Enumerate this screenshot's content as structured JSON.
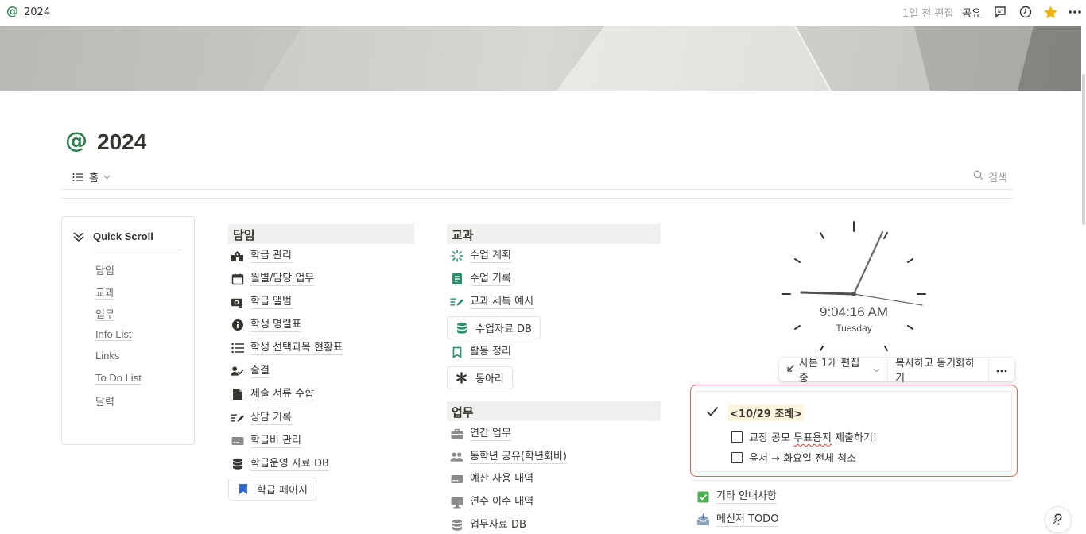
{
  "topbar": {
    "page_icon": "@",
    "page_title": "2024",
    "edited": "1일 전 편집",
    "share": "공유",
    "icons": [
      "comment-icon",
      "clock-history-icon",
      "star-icon",
      "more-icon"
    ]
  },
  "page": {
    "icon": "@",
    "title": "2024"
  },
  "view": {
    "tab_label": "홈",
    "search_label": "검색"
  },
  "quick_scroll": {
    "title": "Quick Scroll",
    "items": [
      "담임",
      "교과",
      "업무",
      "Info List",
      "Links",
      "To Do List",
      "달력"
    ]
  },
  "homeroom": {
    "title": "담임",
    "links": [
      {
        "label": "학급 관리",
        "icon": "school-building-icon"
      },
      {
        "label": "월별/담당 업무",
        "icon": "calendar-icon"
      },
      {
        "label": "학급 앨범",
        "icon": "photo-album-icon"
      },
      {
        "label": "학생 명렬표",
        "icon": "info-circle-icon"
      },
      {
        "label": "학생 선택과목 현황표",
        "icon": "list-icon"
      },
      {
        "label": "출결",
        "icon": "person-check-icon"
      },
      {
        "label": "제출 서류 수합",
        "icon": "document-icon"
      },
      {
        "label": "상담 기록",
        "icon": "write-icon"
      },
      {
        "label": "학급비 관리",
        "icon": "card-icon"
      },
      {
        "label": "학급운영 자료 DB",
        "icon": "database-icon"
      }
    ],
    "pill": {
      "label": "학급 페이지",
      "icon": "bookmark-icon"
    }
  },
  "subject": {
    "title": "교과",
    "links": [
      {
        "label": "수업 계획",
        "icon": "sparkle-loader-icon"
      },
      {
        "label": "수업 기록",
        "icon": "notebook-icon"
      },
      {
        "label": "교과 세특 예시",
        "icon": "write-icon"
      }
    ],
    "pill_db": {
      "label": "수업자료 DB",
      "icon": "database-icon"
    },
    "link_activity": {
      "label": "활동 정리",
      "icon": "bookmark-outline-icon"
    },
    "pill_club": {
      "label": "동아리",
      "icon": "asterisk-icon"
    }
  },
  "work": {
    "title": "업무",
    "links": [
      {
        "label": "연간 업무",
        "icon": "briefcase-icon"
      },
      {
        "label": "동학년 공유(학년회비)",
        "icon": "people-icon"
      },
      {
        "label": "예산 사용 내역",
        "icon": "card-icon"
      },
      {
        "label": "연수 이수 내역",
        "icon": "monitor-icon"
      },
      {
        "label": "업무자료 DB",
        "icon": "database-icon"
      }
    ]
  },
  "clock": {
    "time": "9:04:16 AM",
    "day": "Tuesday"
  },
  "sync_toolbar": {
    "editing": "사본 1개 편집 중",
    "copy_sync": "복사하고 동기화하기"
  },
  "todo": {
    "heading": "<10/29 조례>",
    "items": [
      {
        "pre": "교장 공모 ",
        "misspelled": "투표용지",
        "post": " 제출하기!",
        "checked": false
      },
      {
        "pre": "윤서 → 화요일 전체 청소",
        "misspelled": "",
        "post": "",
        "checked": false
      }
    ]
  },
  "extra_links": [
    {
      "label": "기타 안내사항",
      "icon": "green-checkbox-icon"
    },
    {
      "label": "메신저 TODO",
      "icon": "inbox-tray-icon"
    }
  ],
  "help": {
    "label": "?"
  },
  "colors": {
    "accent_green": "#2e7d4f",
    "section_bg": "#edf0ec",
    "todo_border": "#e16259",
    "highlight": "#fbf3db"
  }
}
